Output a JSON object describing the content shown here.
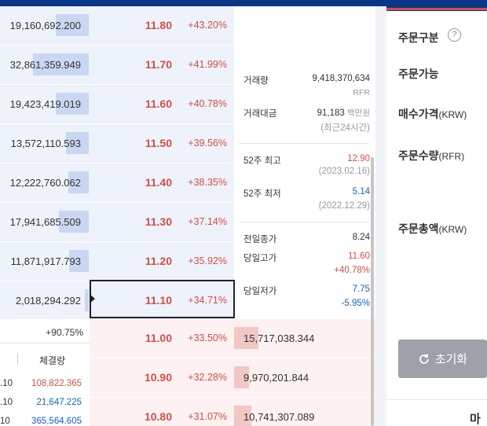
{
  "asks": [
    {
      "qty": "19,160,692.200",
      "price": "11.80",
      "change": "+43.20%",
      "bar": 0.37
    },
    {
      "qty": "32,861,359.949",
      "price": "11.70",
      "change": "+41.99%",
      "bar": 0.63
    },
    {
      "qty": "19,423,419.019",
      "price": "11.60",
      "change": "+40.78%",
      "bar": 0.37
    },
    {
      "qty": "13,572,110.593",
      "price": "11.50",
      "change": "+39.56%",
      "bar": 0.26
    },
    {
      "qty": "12,222,760.062",
      "price": "11.40",
      "change": "+38.35%",
      "bar": 0.23
    },
    {
      "qty": "17,941,685.509",
      "price": "11.30",
      "change": "+37.14%",
      "bar": 0.34
    },
    {
      "qty": "11,871,917.793",
      "price": "11.20",
      "change": "+35.92%",
      "bar": 0.22
    },
    {
      "qty": "2,018,294.292",
      "price": "11.10",
      "change": "+34.71%",
      "bar": 0.04
    }
  ],
  "bids": [
    {
      "qty": "15,717,038.344",
      "price": "11.00",
      "change": "+33.50%",
      "bar": 0.23
    },
    {
      "qty": "9,970,201.844",
      "price": "10.90",
      "change": "+32.28%",
      "bar": 0.14
    },
    {
      "qty": "10,741,307.089",
      "price": "10.80",
      "change": "+31.07%",
      "bar": 0.16
    }
  ],
  "stats": {
    "volume_label": "거래량",
    "volume_value": "9,418,370,634",
    "volume_unit": "RFR",
    "amount_label": "거래대금",
    "amount_value": "91,183",
    "amount_unit": "백만원",
    "amount_note": "(최근24시간)",
    "high52_label": "52주 최고",
    "high52_value": "12.90",
    "high52_date": "(2023.02.16)",
    "low52_label": "52주 최저",
    "low52_value": "5.14",
    "low52_date": "(2022.12.29)",
    "prev_close_label": "전일종가",
    "prev_close_value": "8.24",
    "day_high_label": "당일고가",
    "day_high_value": "11.60",
    "day_high_change": "+40.78%",
    "day_low_label": "당일저가",
    "day_low_value": "7.75",
    "day_low_change": "-5.95%"
  },
  "trades": {
    "strength": "+90.75%",
    "header": "체결량",
    "rows": [
      {
        "price": ".10",
        "qty": "108,822.365",
        "side": "sell"
      },
      {
        "price": ".10",
        "qty": "21,647.225",
        "side": "buy"
      },
      {
        "price": "10",
        "qty": "365,564.605",
        "side": "buy"
      }
    ]
  },
  "order": {
    "type_label": "주문구분",
    "help_glyph": "?",
    "available_label": "주문가능",
    "price_label": "매수가격",
    "price_unit": "(KRW)",
    "qty_label": "주문수량",
    "qty_unit": "(RFR)",
    "total_label": "주문총액",
    "total_unit": "(KRW)",
    "reset_label": "초기화",
    "reset_icon": "refresh-icon",
    "market_label": "마켓"
  },
  "colors": {
    "up": "#d24f45",
    "down": "#1261c4",
    "ask_bg": "#eef2fb",
    "bid_bg": "#fdf1f1"
  }
}
